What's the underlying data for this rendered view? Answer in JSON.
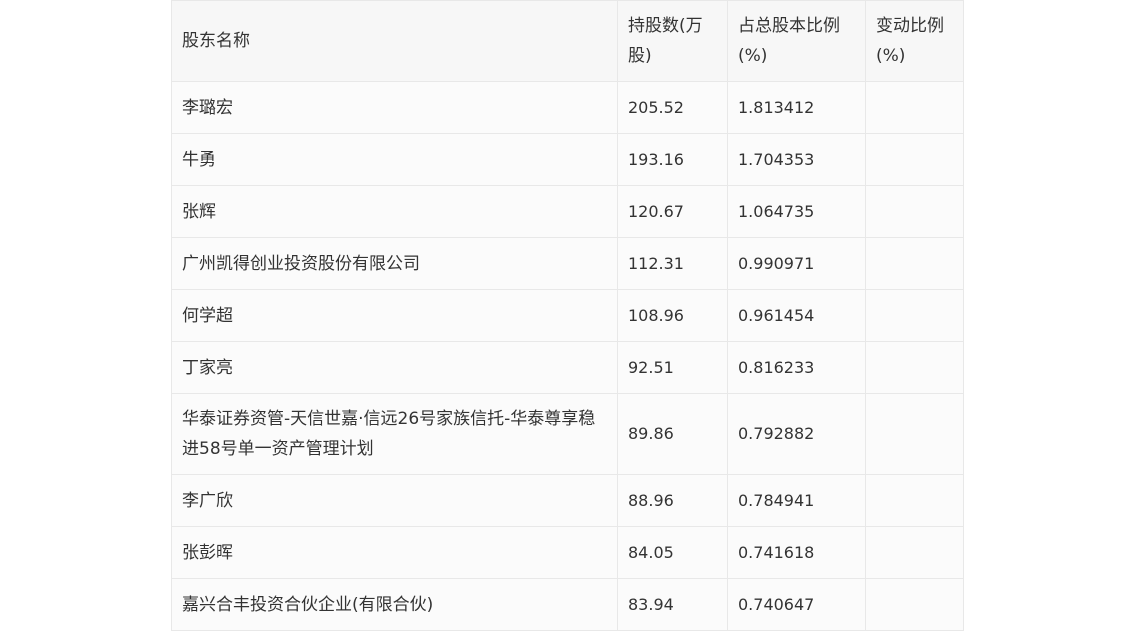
{
  "table": {
    "headers": [
      "股东名称",
      "持股数(万股)",
      "占总股本比例(%)",
      "变动比例(%)"
    ],
    "rows": [
      {
        "name": "李璐宏",
        "shares": "205.52",
        "ratio": "1.813412",
        "change": ""
      },
      {
        "name": "牛勇",
        "shares": "193.16",
        "ratio": "1.704353",
        "change": ""
      },
      {
        "name": "张辉",
        "shares": "120.67",
        "ratio": "1.064735",
        "change": ""
      },
      {
        "name": "广州凯得创业投资股份有限公司",
        "shares": "112.31",
        "ratio": "0.990971",
        "change": ""
      },
      {
        "name": "何学超",
        "shares": "108.96",
        "ratio": "0.961454",
        "change": ""
      },
      {
        "name": "丁家亮",
        "shares": "92.51",
        "ratio": "0.816233",
        "change": ""
      },
      {
        "name": "华泰证券资管-天信世嘉·信远26号家族信托-华泰尊享稳进58号单一资产管理计划",
        "shares": "89.86",
        "ratio": "0.792882",
        "change": ""
      },
      {
        "name": "李广欣",
        "shares": "88.96",
        "ratio": "0.784941",
        "change": ""
      },
      {
        "name": "张彭晖",
        "shares": "84.05",
        "ratio": "0.741618",
        "change": ""
      },
      {
        "name": "嘉兴合丰投资合伙企业(有限合伙)",
        "shares": "83.94",
        "ratio": "0.740647",
        "change": ""
      }
    ]
  }
}
